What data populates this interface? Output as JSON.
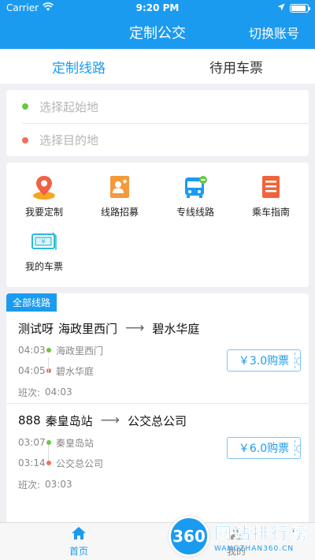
{
  "status": {
    "carrier": "Carrier",
    "time": "9:20 PM"
  },
  "header": {
    "title": "定制公交",
    "right_action": "切换账号"
  },
  "tabs": [
    {
      "label": "定制线路",
      "active": true
    },
    {
      "label": "待用车票",
      "active": false
    }
  ],
  "search": {
    "origin_placeholder": "选择起始地",
    "destination_placeholder": "选择目的地"
  },
  "menu": [
    {
      "label": "我要定制",
      "icon": "map-pin-icon"
    },
    {
      "label": "线路招募",
      "icon": "recruit-icon"
    },
    {
      "label": "专线线路",
      "icon": "bus-icon"
    },
    {
      "label": "乘车指南",
      "icon": "guide-icon"
    },
    {
      "label": "我的车票",
      "icon": "ticket-icon"
    }
  ],
  "routes_tag": "全部线路",
  "routes": [
    {
      "name": "测试呀",
      "from": "海政里西门",
      "to": "碧水华庭",
      "stops": [
        {
          "time": "04:03",
          "name": "海政里西门"
        },
        {
          "time": "04:05",
          "name": "碧水华庭"
        }
      ],
      "shift_label": "班次:",
      "shift_time": "04:03",
      "price_label": "￥3.0购票"
    },
    {
      "name": "888",
      "from": "秦皇岛站",
      "to": "公交总公司",
      "stops": [
        {
          "time": "03:07",
          "name": "秦皇岛站"
        },
        {
          "time": "03:14",
          "name": "公交总公司"
        }
      ],
      "shift_label": "班次:",
      "shift_time": "03:03",
      "price_label": "￥6.0购票"
    }
  ],
  "bottom_nav": [
    {
      "label": "首页",
      "active": true
    },
    {
      "label": "我的",
      "active": false
    }
  ],
  "watermark": {
    "badge": "360",
    "main": "网站排行榜",
    "sub": "WANGZHAN360.CN"
  },
  "colors": {
    "primary": "#1b9bf0",
    "green_dot": "#6cc644",
    "red_dot": "#f0715a"
  }
}
